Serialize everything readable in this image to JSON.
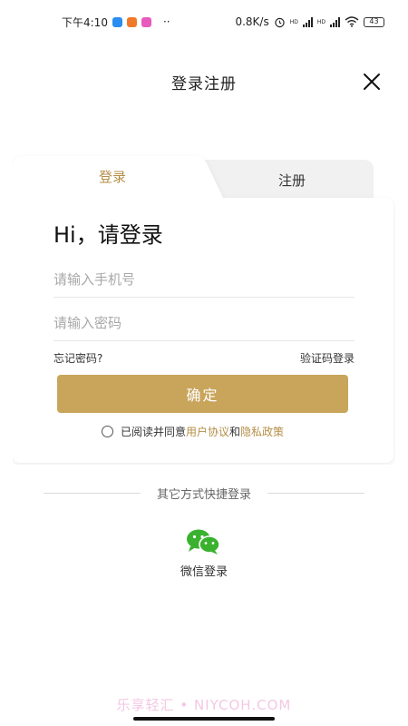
{
  "status_bar": {
    "time": "下午4:10",
    "dots": "··",
    "network_speed": "0.8K/s",
    "hd1": "HD",
    "hd2": "HD",
    "battery": "43",
    "icons": [
      "alarm-icon",
      "signal-icon",
      "wifi-icon",
      "battery-icon"
    ]
  },
  "header": {
    "title": "登录注册",
    "close_icon": "close-icon"
  },
  "tabs": {
    "login": "登录",
    "register": "注册"
  },
  "form": {
    "greeting": "Hi，请登录",
    "phone_placeholder": "请输入手机号",
    "password_placeholder": "请输入密码",
    "forgot_password": "忘记密码?",
    "code_login": "验证码登录",
    "confirm": "确定",
    "agree_prefix": "已阅读并同意",
    "user_agreement": "用户协议",
    "and": "和",
    "privacy_policy": "隐私政策"
  },
  "other_login": {
    "title": "其它方式快捷登录",
    "wechat_label": "微信登录"
  },
  "watermark": "乐享轻汇 • NIYCOH.COM",
  "colors": {
    "accent": "#c9a55c",
    "accent_text": "#b58f47",
    "wechat": "#3ab22f",
    "tab_inactive": "#f1f1f1"
  }
}
